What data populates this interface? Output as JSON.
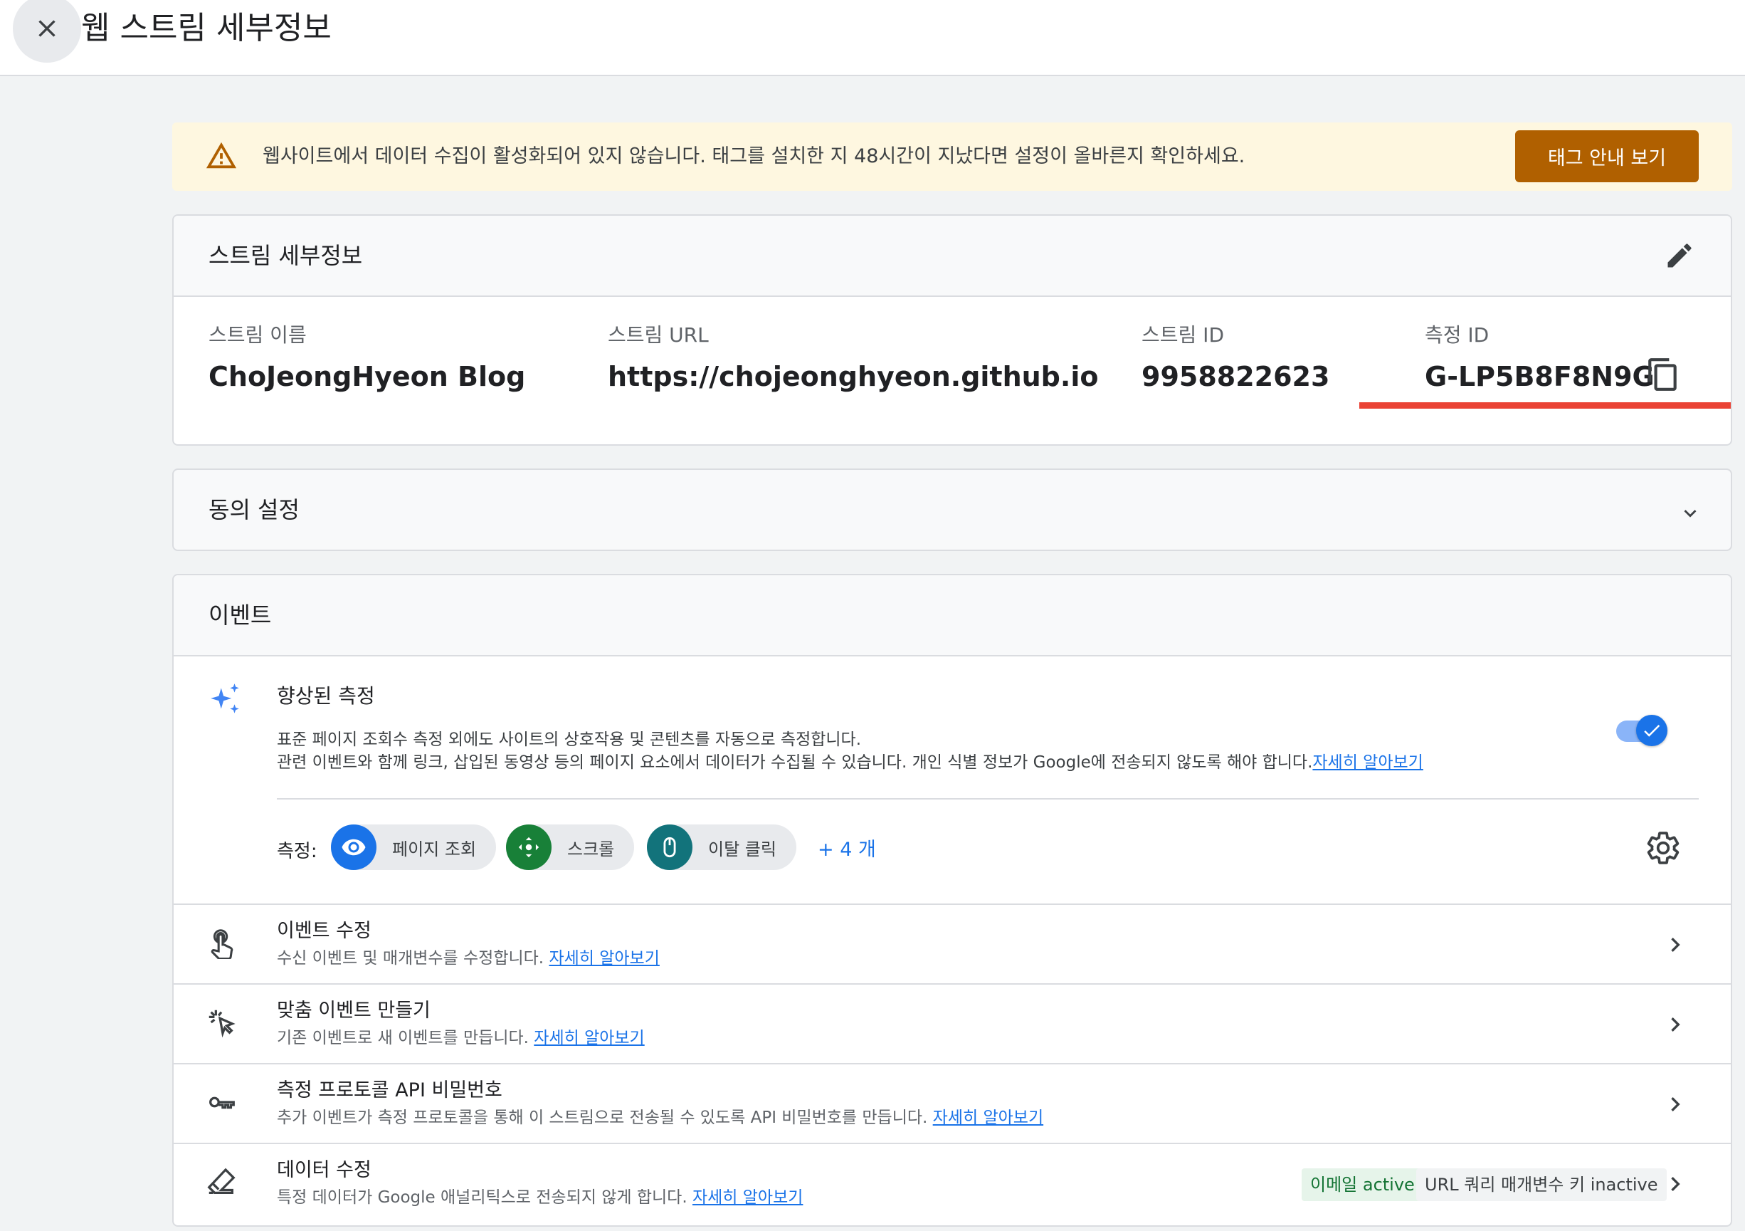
{
  "header": {
    "title": "웹 스트림 세부정보"
  },
  "banner": {
    "text": "웹사이트에서 데이터 수집이 활성화되어 있지 않습니다. 태그를 설치한 지 48시간이 지났다면 설정이 올바른지 확인하세요.",
    "button_label": "태그 안내 보기",
    "button_color": "#b06000",
    "background": "#fef7e0"
  },
  "stream_details": {
    "title": "스트림 세부정보",
    "fields": [
      {
        "label": "스트림 이름",
        "value": "ChoJeongHyeon Blog"
      },
      {
        "label": "스트림 URL",
        "value": "https://chojeonghyeon.github.io"
      },
      {
        "label": "스트림 ID",
        "value": "9958822623"
      },
      {
        "label": "측정 ID",
        "value": "G-LP5B8F8N9G"
      }
    ],
    "highlight_color": "#ea4335"
  },
  "consent": {
    "title": "동의 설정"
  },
  "events": {
    "title": "이벤트",
    "enhanced": {
      "title": "향상된 측정",
      "desc_line1": "표준 페이지 조회수 측정 외에도 사이트의 상호작용 및 콘텐츠를 자동으로 측정합니다.",
      "desc_line2": "관련 이벤트와 함께 링크, 삽입된 동영상 등의 페이지 요소에서 데이터가 수집될 수 있습니다. 개인 식별 정보가 Google에 전송되지 않도록 해야 합니다.",
      "learn_more": "자세히 알아보기",
      "toggle_on": true,
      "measure_label": "측정:",
      "chips": [
        {
          "label": "페이지 조회",
          "icon": "eye-icon",
          "color": "#1a73e8"
        },
        {
          "label": "스크롤",
          "icon": "scroll-arrows-icon",
          "color": "#188038"
        },
        {
          "label": "이탈 클릭",
          "icon": "mouse-icon",
          "color": "#12737b"
        }
      ],
      "more": "+ 4 개"
    },
    "rows": [
      {
        "title": "이벤트 수정",
        "subtitle": "수신 이벤트 및 매개변수를 수정합니다.",
        "link": "자세히 알아보기",
        "icon": "touch-icon"
      },
      {
        "title": "맞춤 이벤트 만들기",
        "subtitle": "기존 이벤트로 새 이벤트를 만듭니다.",
        "link": "자세히 알아보기",
        "icon": "click-icon"
      },
      {
        "title": "측정 프로토콜 API 비밀번호",
        "subtitle": "추가 이벤트가 측정 프로토콜을 통해 이 스트림으로 전송될 수 있도록 API 비밀번호를 만듭니다.",
        "link": "자세히 알아보기",
        "icon": "key-icon"
      },
      {
        "title": "데이터 수정",
        "subtitle": "특정 데이터가 Google 애널리틱스로 전송되지 않게 합니다.",
        "link": "자세히 알아보기",
        "icon": "eraser-icon"
      }
    ],
    "badges": {
      "email": "이메일 active",
      "email_bg": "#e6f4ea",
      "email_color": "#137333",
      "url": "URL 쿼리 매개변수 키 inactive",
      "url_bg": "#f1f3f4"
    }
  }
}
